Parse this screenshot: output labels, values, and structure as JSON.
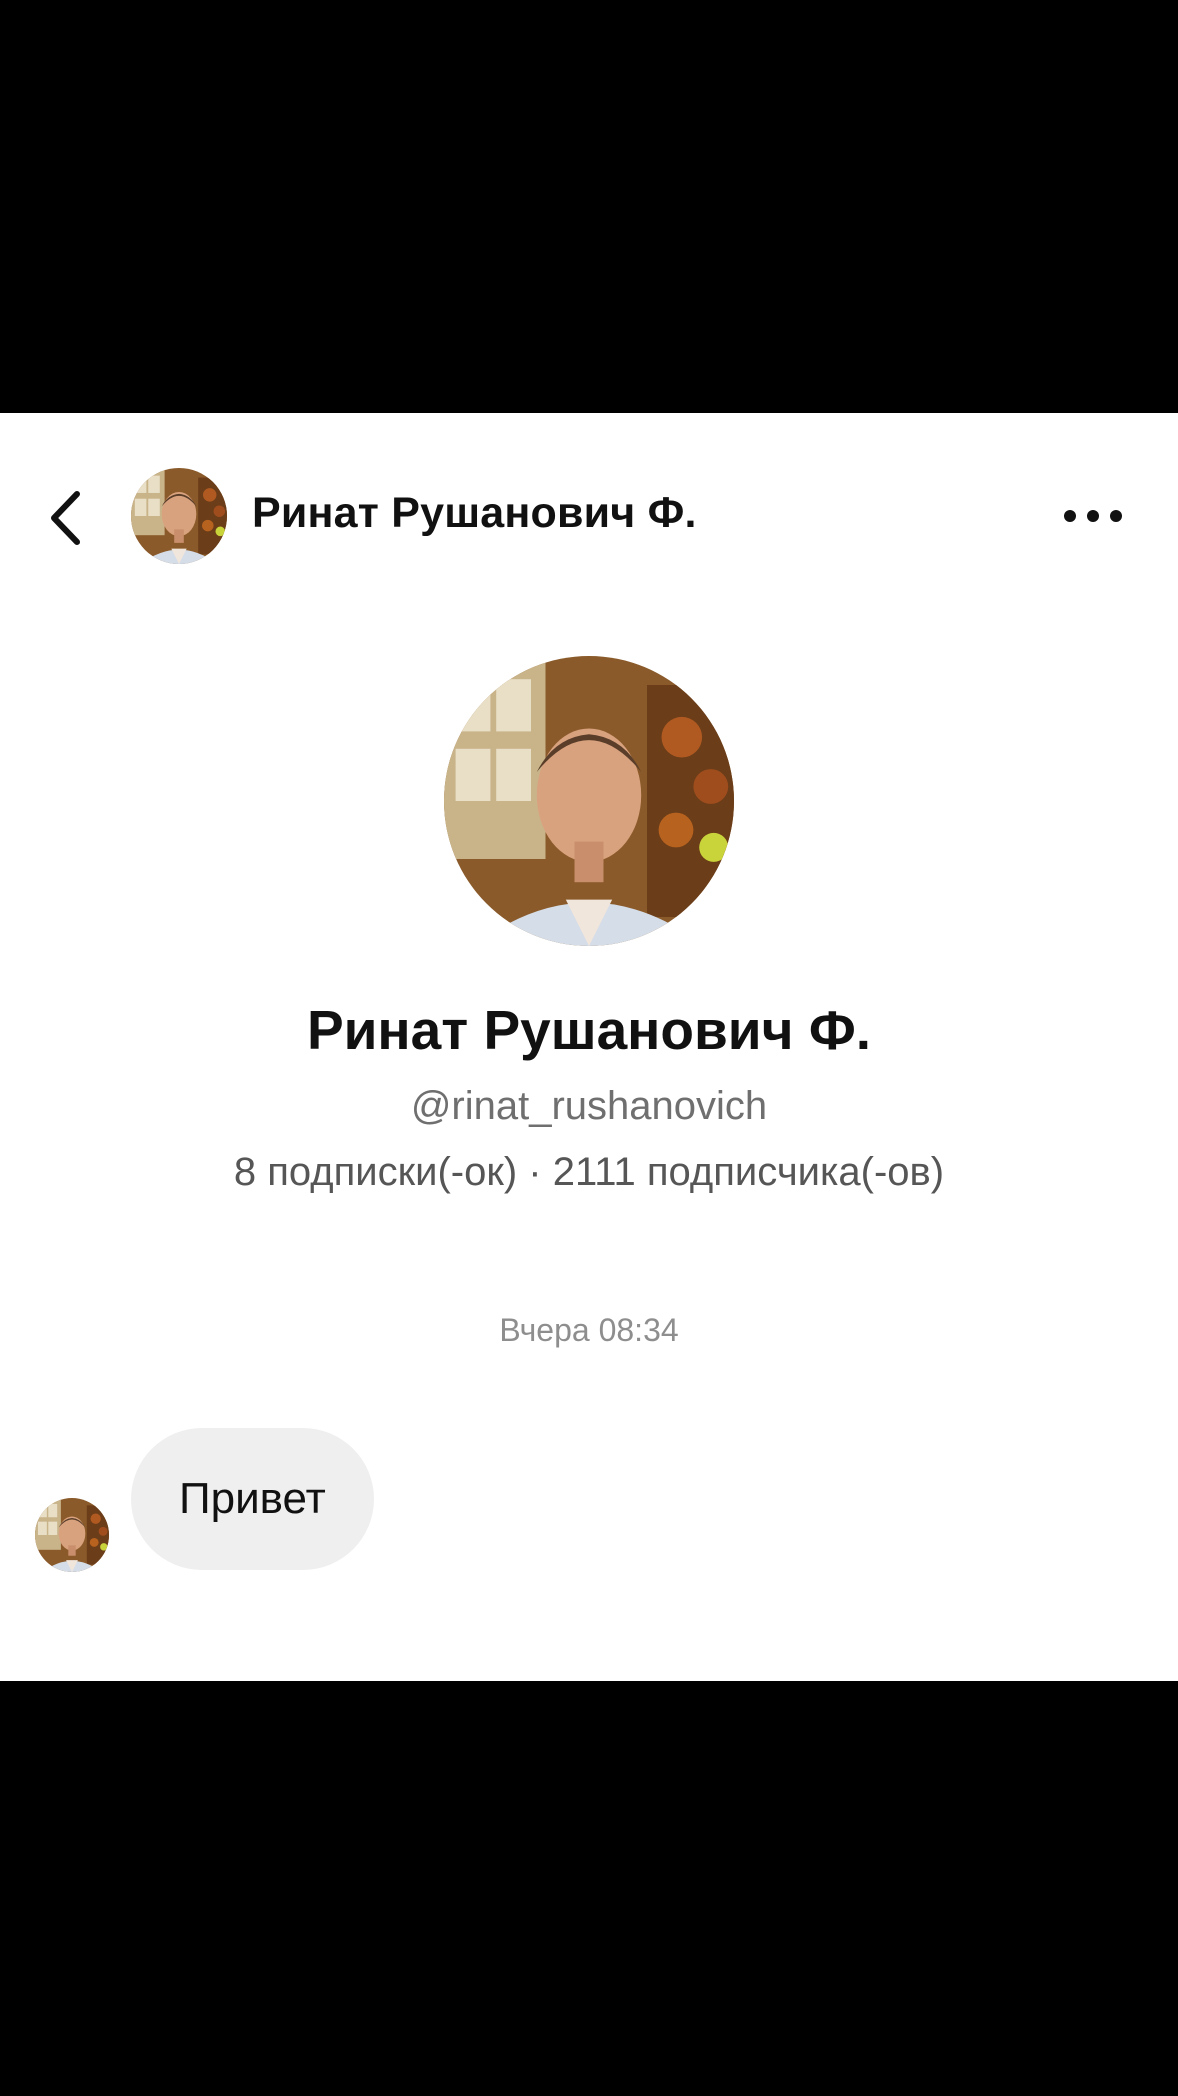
{
  "header": {
    "name": "Ринат Рушанович Ф.",
    "back_icon": "chevron-left-icon",
    "more_icon": "more-horizontal-icon"
  },
  "profile": {
    "name": "Ринат Рушанович Ф.",
    "handle": "@rinat_rushanovich",
    "stats": "8 подписки(-ок) · 2111 подписчика(-ов)"
  },
  "chat": {
    "timestamp": "Вчера 08:34",
    "messages": [
      {
        "text": "Привет",
        "from": "contact"
      }
    ]
  },
  "colors": {
    "background": "#ffffff",
    "frame": "#000000",
    "bubble": "#efefef",
    "text": "#111111",
    "secondary_text": "#6f6f6f",
    "timestamp": "#8e8e8e"
  }
}
